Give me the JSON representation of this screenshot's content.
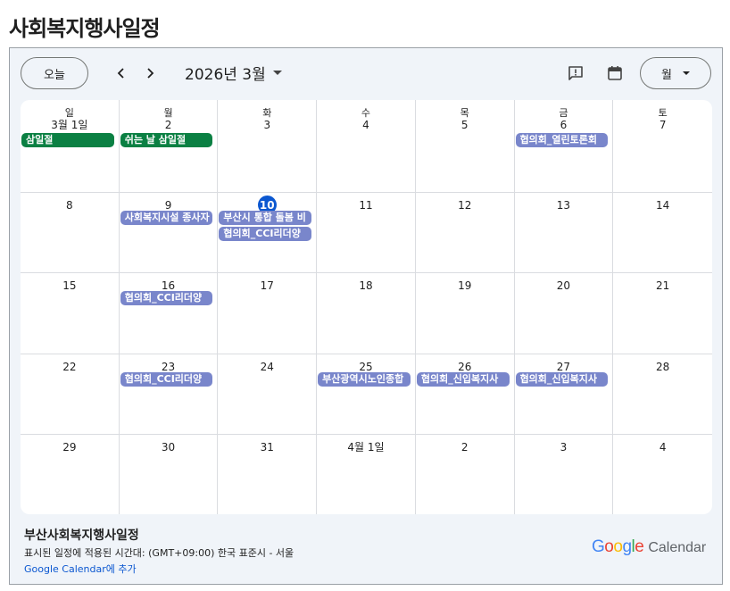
{
  "page_title": "사회복지행사일정",
  "toolbar": {
    "today_label": "오늘",
    "month_label": "2026년 3월",
    "view_label": "월",
    "prev_icon": "chevron-left-icon",
    "next_icon": "chevron-right-icon",
    "feedback_icon": "feedback-icon",
    "calendar_icon": "calendar-icon"
  },
  "weekdays": [
    "일",
    "월",
    "화",
    "수",
    "목",
    "금",
    "토"
  ],
  "weeks": [
    [
      {
        "day": "3월 1일",
        "events": [
          {
            "title": "삼일절",
            "color": "green"
          }
        ]
      },
      {
        "day": "2",
        "events": [
          {
            "title": "쉬는 날 삼일절",
            "color": "green"
          }
        ]
      },
      {
        "day": "3",
        "events": []
      },
      {
        "day": "4",
        "events": []
      },
      {
        "day": "5",
        "events": []
      },
      {
        "day": "6",
        "events": [
          {
            "title": "협의회_열린토론회",
            "color": "blue"
          }
        ]
      },
      {
        "day": "7",
        "events": []
      }
    ],
    [
      {
        "day": "8",
        "events": []
      },
      {
        "day": "9",
        "events": [
          {
            "title": "사회복지시설 종사자",
            "color": "blue"
          }
        ]
      },
      {
        "day": "10",
        "today": true,
        "events": [
          {
            "title": "부산시 통합 돌봄 비",
            "color": "blue"
          },
          {
            "title": "협의회_CCI리더양",
            "color": "blue"
          }
        ]
      },
      {
        "day": "11",
        "events": []
      },
      {
        "day": "12",
        "events": []
      },
      {
        "day": "13",
        "events": []
      },
      {
        "day": "14",
        "events": []
      }
    ],
    [
      {
        "day": "15",
        "events": []
      },
      {
        "day": "16",
        "events": [
          {
            "title": "협의회_CCI리더양",
            "color": "blue"
          }
        ]
      },
      {
        "day": "17",
        "events": []
      },
      {
        "day": "18",
        "events": []
      },
      {
        "day": "19",
        "events": []
      },
      {
        "day": "20",
        "events": []
      },
      {
        "day": "21",
        "events": []
      }
    ],
    [
      {
        "day": "22",
        "events": []
      },
      {
        "day": "23",
        "events": [
          {
            "title": "협의회_CCI리더양",
            "color": "blue"
          }
        ]
      },
      {
        "day": "24",
        "events": []
      },
      {
        "day": "25",
        "events": [
          {
            "title": "부산광역시노인종합",
            "color": "blue"
          }
        ]
      },
      {
        "day": "26",
        "events": [
          {
            "title": "협의회_신입복지사",
            "color": "blue"
          }
        ]
      },
      {
        "day": "27",
        "events": [
          {
            "title": "협의회_신입복지사",
            "color": "blue"
          }
        ]
      },
      {
        "day": "28",
        "events": []
      }
    ],
    [
      {
        "day": "29",
        "events": []
      },
      {
        "day": "30",
        "events": []
      },
      {
        "day": "31",
        "events": []
      },
      {
        "day": "4월 1일",
        "events": []
      },
      {
        "day": "2",
        "events": []
      },
      {
        "day": "3",
        "events": []
      },
      {
        "day": "4",
        "events": []
      }
    ]
  ],
  "colors": {
    "green": "#0b8043",
    "blue": "#7986cb",
    "today": "#0b57d0"
  },
  "footer": {
    "calendar_name": "부산사회복지행사일정",
    "timezone_text": "표시된 일정에 적용된 시간대: (GMT+09:00) 한국 표준시 - 서울",
    "add_link": "Google Calendar에 추가",
    "logo_google": "Google",
    "logo_calendar": "Calendar"
  }
}
